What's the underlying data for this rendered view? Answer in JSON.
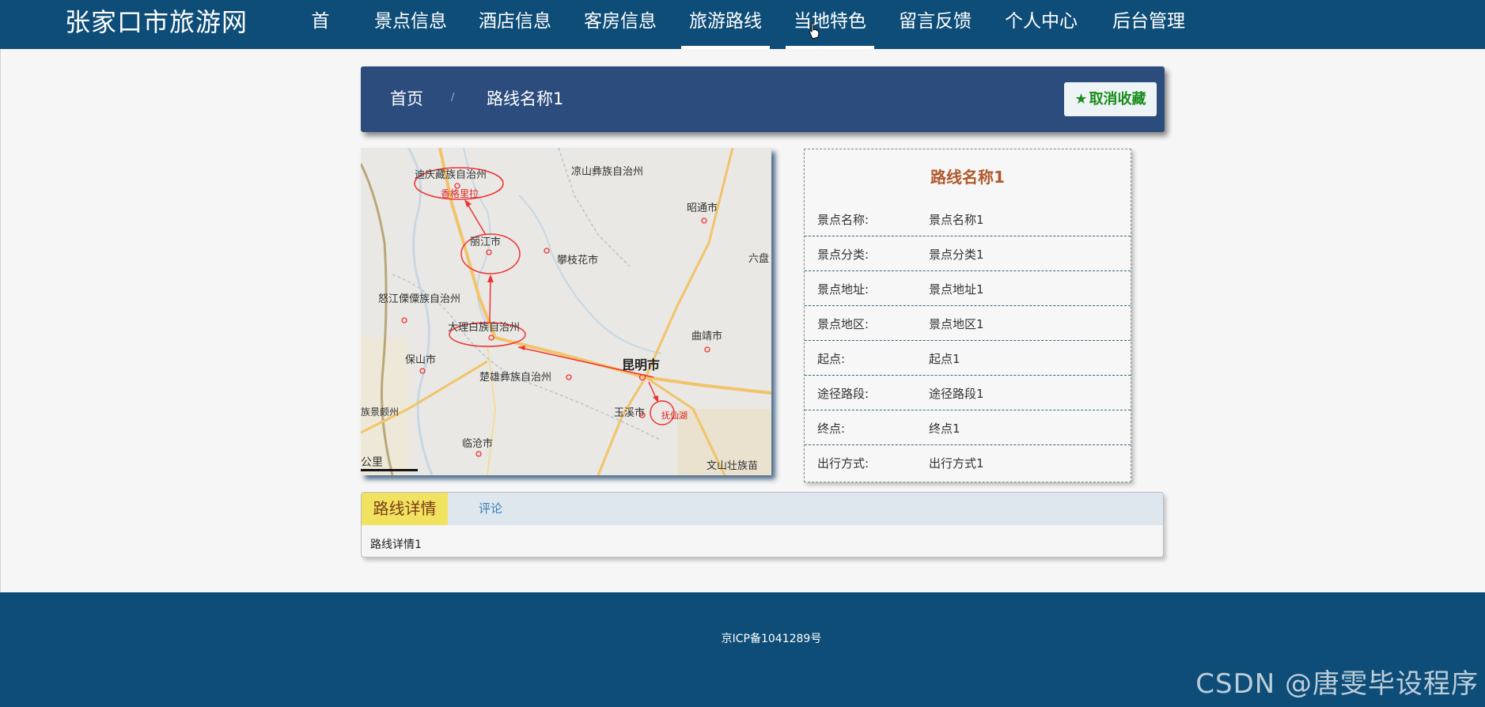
{
  "header": {
    "site_title": "张家口市旅游网",
    "nav": [
      "首页",
      "景点信息",
      "酒店信息",
      "客房信息",
      "旅游路线",
      "当地特色",
      "留言反馈",
      "个人中心",
      "后台管理"
    ],
    "active_nav": "旅游路线"
  },
  "breadcrumb": {
    "home": "首页",
    "separator": "/",
    "current": "路线名称1"
  },
  "favorite_button": {
    "icon": "star-icon",
    "label": "取消收藏"
  },
  "map": {
    "labels": [
      "迪庆藏族自治州",
      "香格里拉",
      "凉山彝族自治州",
      "昭通市",
      "丽江市",
      "攀枝花市",
      "六盘",
      "怒江傈僳族自治州",
      "大理白族自治州",
      "曲靖市",
      "保山市",
      "昆明市",
      "楚雄彝族自治州",
      "玉溪市",
      "抚仙湖",
      "族景颇州",
      "临沧市",
      "文山壮族苗",
      "公里"
    ]
  },
  "route_info": {
    "title": "路线名称1",
    "rows": [
      {
        "label": "景点名称:",
        "value": "景点名称1"
      },
      {
        "label": "景点分类:",
        "value": "景点分类1"
      },
      {
        "label": "景点地址:",
        "value": "景点地址1"
      },
      {
        "label": "景点地区:",
        "value": "景点地区1"
      },
      {
        "label": "起点:",
        "value": "起点1"
      },
      {
        "label": "途径路段:",
        "value": "途径路段1"
      },
      {
        "label": "终点:",
        "value": "终点1"
      },
      {
        "label": "出行方式:",
        "value": "出行方式1"
      }
    ]
  },
  "detail_tabs": {
    "tabs": [
      "路线详情",
      "评论"
    ],
    "active": "路线详情",
    "content": "路线详情1"
  },
  "footer": {
    "icp": "京ICP备1041289号",
    "watermark": "CSDN @唐雯毕设程序"
  },
  "colors": {
    "header_bg": "#0e4d78",
    "breadcrumb_bg": "#2b4c7d",
    "favorite_text": "#1a8c1a",
    "route_title": "#b0582b",
    "active_tab_bg": "#f1e35f"
  }
}
